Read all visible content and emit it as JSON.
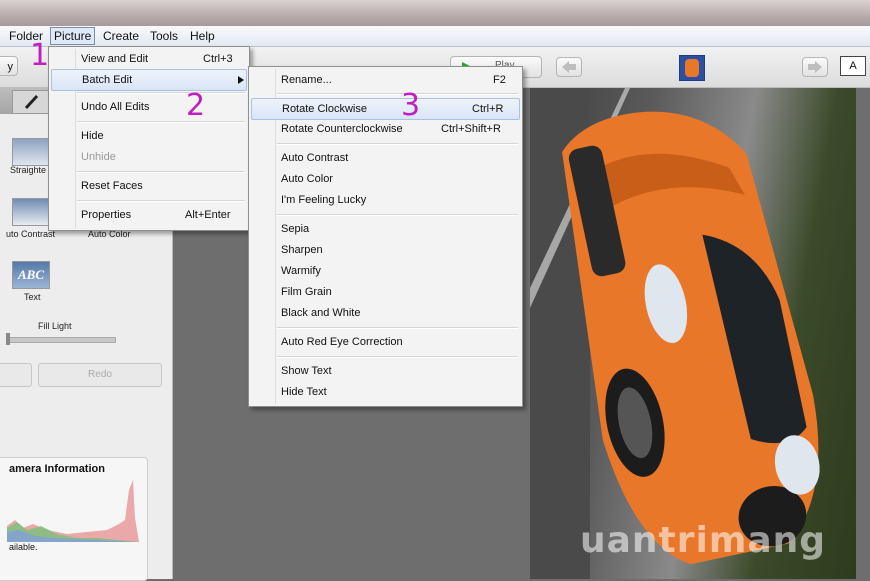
{
  "menubar": {
    "items": [
      "Folder",
      "Picture",
      "Create",
      "Tools",
      "Help"
    ]
  },
  "toolbar": {
    "play_label": "Play",
    "left_cut_label": "y",
    "text_box_label": "A"
  },
  "picture_menu": {
    "items": [
      {
        "label": "View and Edit",
        "shortcut": "Ctrl+3"
      },
      {
        "label": "Batch Edit",
        "shortcut": ""
      },
      {
        "label": "Undo All Edits",
        "shortcut": ""
      },
      {
        "label": "Hide",
        "shortcut": ""
      },
      {
        "label": "Unhide",
        "shortcut": ""
      },
      {
        "label": "Reset Faces",
        "shortcut": ""
      },
      {
        "label": "Properties",
        "shortcut": "Alt+Enter"
      }
    ]
  },
  "batch_menu": {
    "items": [
      {
        "label": "Rename...",
        "shortcut": "F2"
      },
      {
        "label": "Rotate Clockwise",
        "shortcut": "Ctrl+R"
      },
      {
        "label": "Rotate Counterclockwise",
        "shortcut": "Ctrl+Shift+R"
      },
      {
        "label": "Auto Contrast",
        "shortcut": ""
      },
      {
        "label": "Auto Color",
        "shortcut": ""
      },
      {
        "label": "I'm Feeling Lucky",
        "shortcut": ""
      },
      {
        "label": "Sepia",
        "shortcut": ""
      },
      {
        "label": "Sharpen",
        "shortcut": ""
      },
      {
        "label": "Warmify",
        "shortcut": ""
      },
      {
        "label": "Film Grain",
        "shortcut": ""
      },
      {
        "label": "Black and White",
        "shortcut": ""
      },
      {
        "label": "Auto Red Eye Correction",
        "shortcut": ""
      },
      {
        "label": "Show Text",
        "shortcut": ""
      },
      {
        "label": "Hide Text",
        "shortcut": ""
      }
    ]
  },
  "left_panel": {
    "straighten_label": "Straighte",
    "auto_contrast_label": "uto Contrast",
    "auto_color_label": "Auto Color",
    "text_thumb_label": "ABC",
    "text_label": "Text",
    "fill_light_label": "Fill Light",
    "redo_label": "Redo",
    "camera_info_title": "amera Information",
    "camera_info_status": "ailable."
  },
  "annotations": {
    "step1": "1",
    "step2": "2",
    "step3": "3"
  },
  "watermark": "uantrimang",
  "colors": {
    "step_marker": "#c020c0",
    "car_body": "#e8772a",
    "menu_highlight": "#d9e5f6"
  }
}
